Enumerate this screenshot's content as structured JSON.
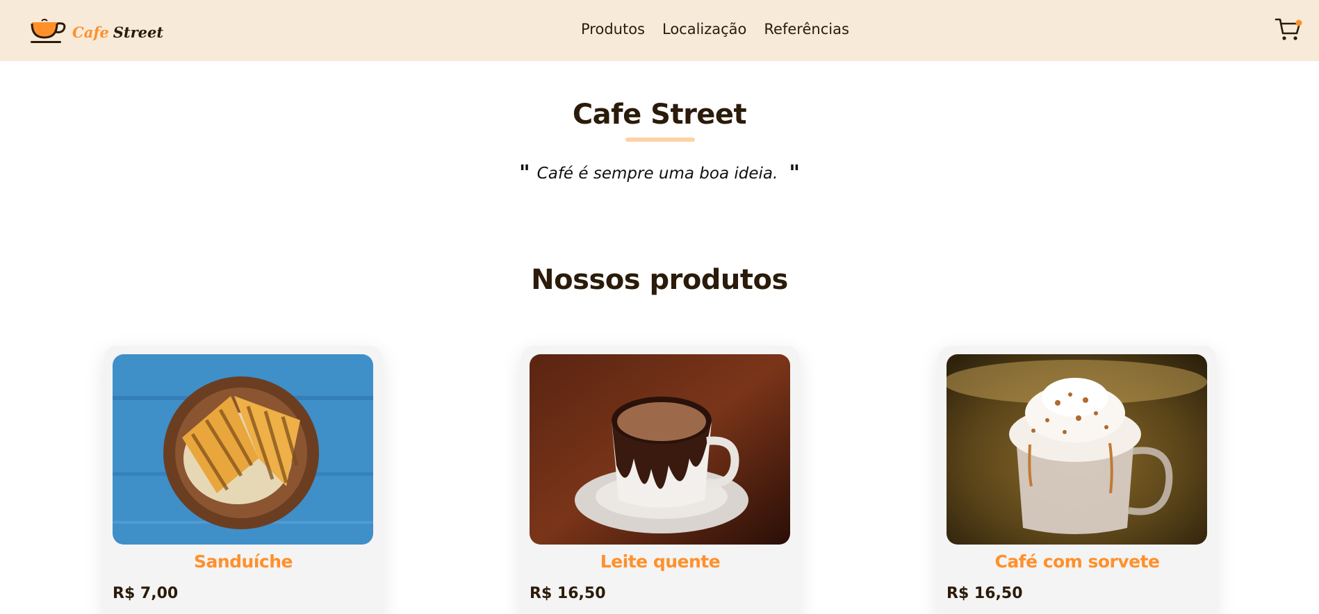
{
  "header": {
    "logo": {
      "part1": "Cafe",
      "part2": "Street",
      "icon": "coffee-cup-logo"
    },
    "nav": [
      {
        "label": "Produtos"
      },
      {
        "label": "Localização"
      },
      {
        "label": "Referências"
      }
    ],
    "cart_icon": "cart-icon",
    "cart_badge_color": "#ff902b"
  },
  "hero": {
    "title": "Cafe Street",
    "quote_open": "\"",
    "quote": "Café é sempre uma boa ideia.",
    "quote_close": "\""
  },
  "products": {
    "title": "Nossos produtos",
    "items": [
      {
        "name": "Sanduíche",
        "price": "R$ 7,00",
        "image": "sandwich-photo"
      },
      {
        "name": "Leite quente",
        "price": "R$ 16,50",
        "image": "hot-milk-photo"
      },
      {
        "name": "Café com sorvete",
        "price": "R$ 16,50",
        "image": "coffee-ice-cream-photo"
      }
    ]
  },
  "colors": {
    "header_bg": "#f7ead9",
    "accent": "#ff902b",
    "text_dark": "#2b1b0a",
    "underline": "#ffd1a3"
  }
}
